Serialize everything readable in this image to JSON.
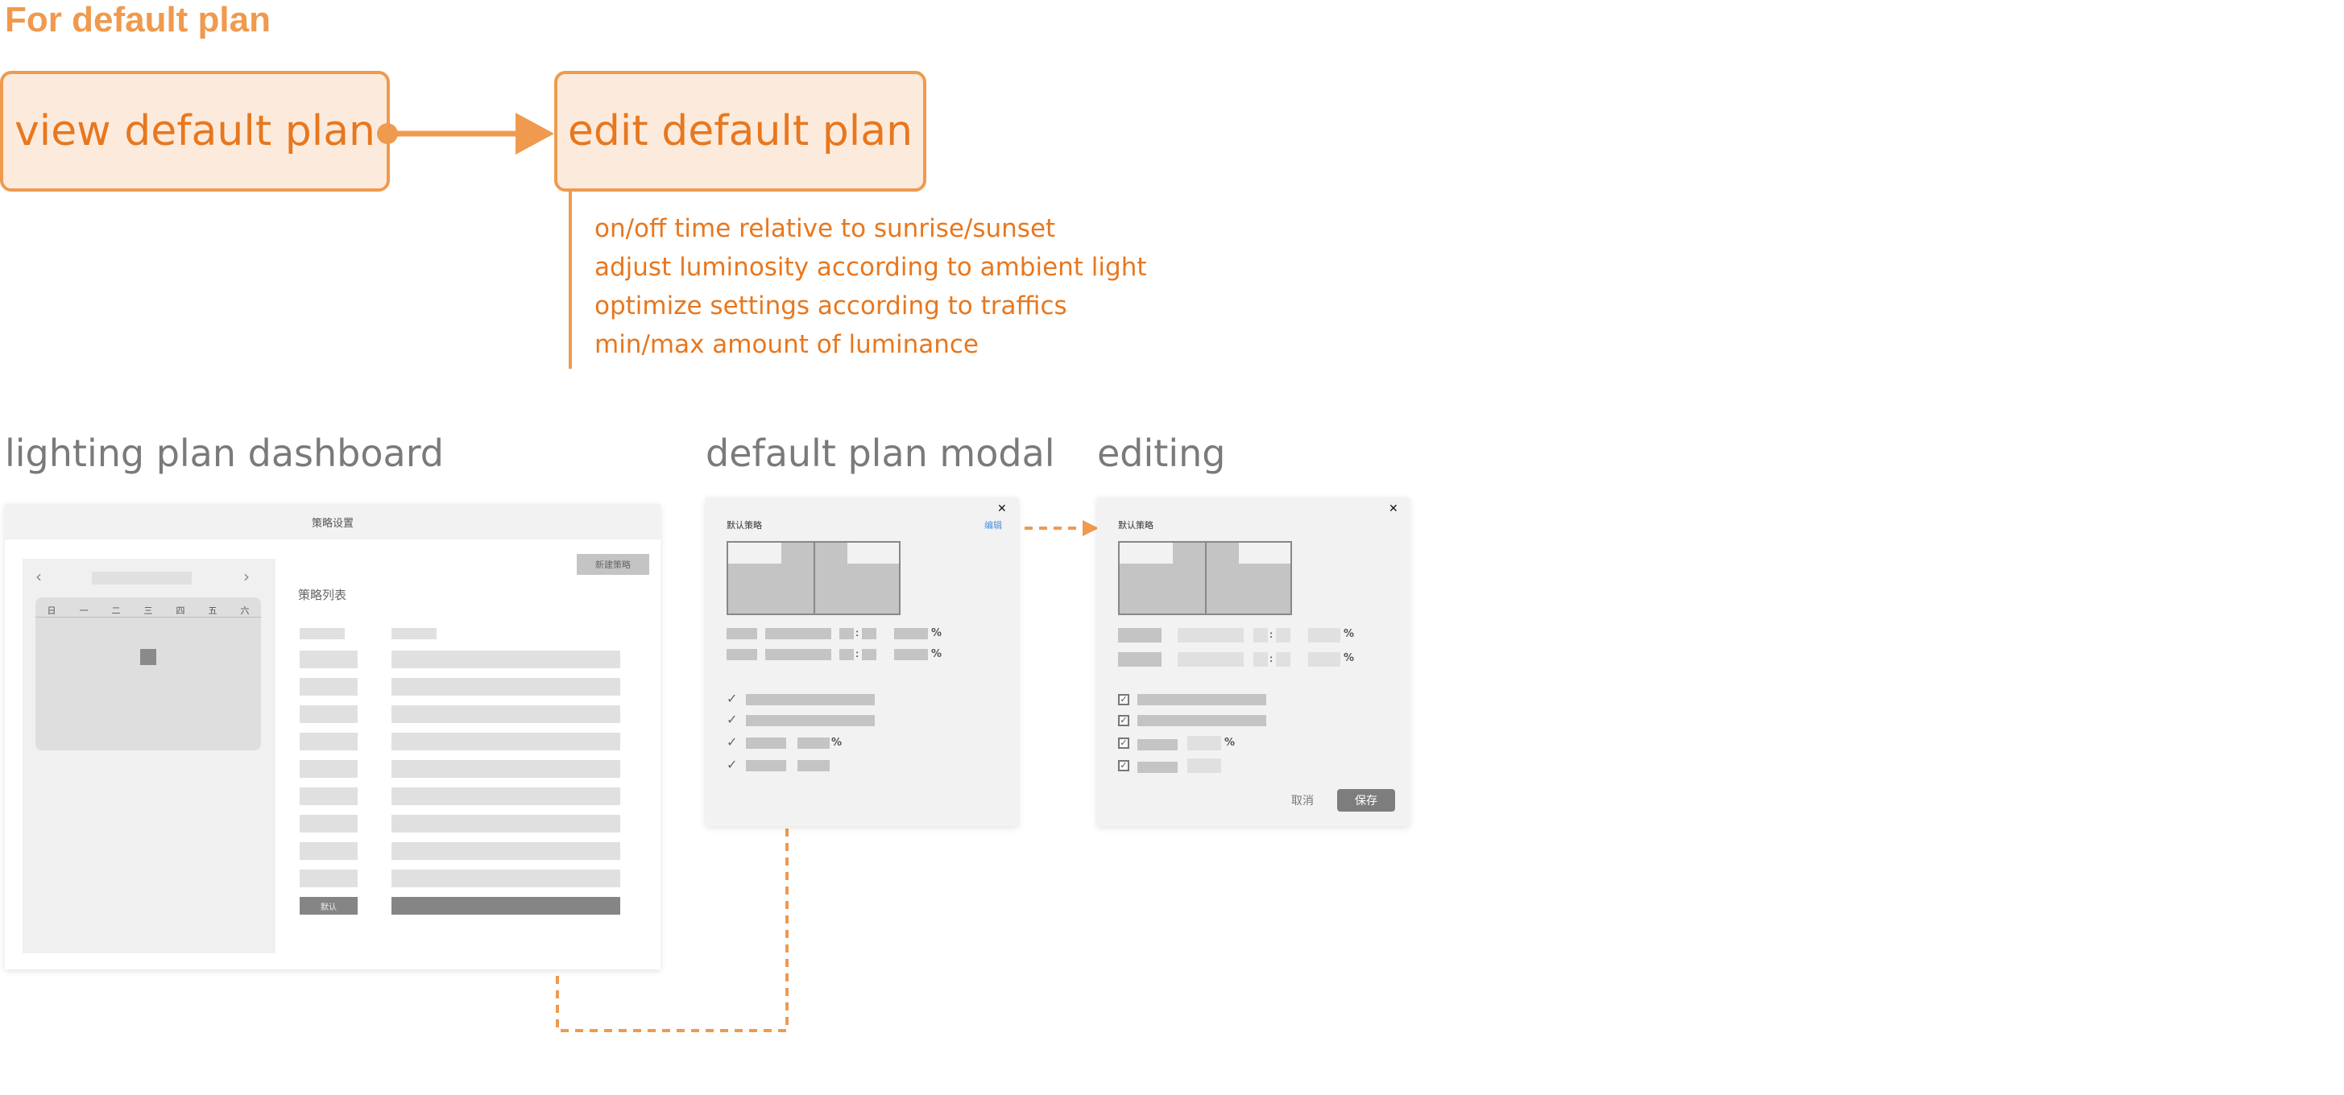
{
  "title": "For default plan",
  "flow": {
    "view_label": "view default plan",
    "edit_label": "edit default plan",
    "notes": [
      "on/off time relative to sunrise/sunset",
      "adjust luminosity according to ambient light",
      "optimize settings according to traffics",
      "min/max amount of luminance"
    ]
  },
  "sections": {
    "dashboard": "lighting plan dashboard",
    "modal": "default plan modal",
    "editing": "editing"
  },
  "dashboard": {
    "header": "策略设置",
    "new_button": "新建策略",
    "list_title": "策略列表",
    "prev_icon": "‹",
    "next_icon": "›",
    "weekdays": [
      "日",
      "一",
      "二",
      "三",
      "四",
      "五",
      "六"
    ],
    "default_label": "默认"
  },
  "modal": {
    "title": "默认策略",
    "edit_link": "编辑",
    "close_icon": "✕",
    "percent": "%",
    "colon": ":",
    "check": "✓"
  },
  "editing": {
    "title": "默认策略",
    "close_icon": "✕",
    "percent": "%",
    "colon": ":",
    "check": "✓",
    "cancel": "取消",
    "save": "保存"
  },
  "colors": {
    "accent": "#EF9A4E",
    "accent_text": "#E8771E",
    "box_fill": "#FCEBDD",
    "link": "#4A90E2"
  }
}
